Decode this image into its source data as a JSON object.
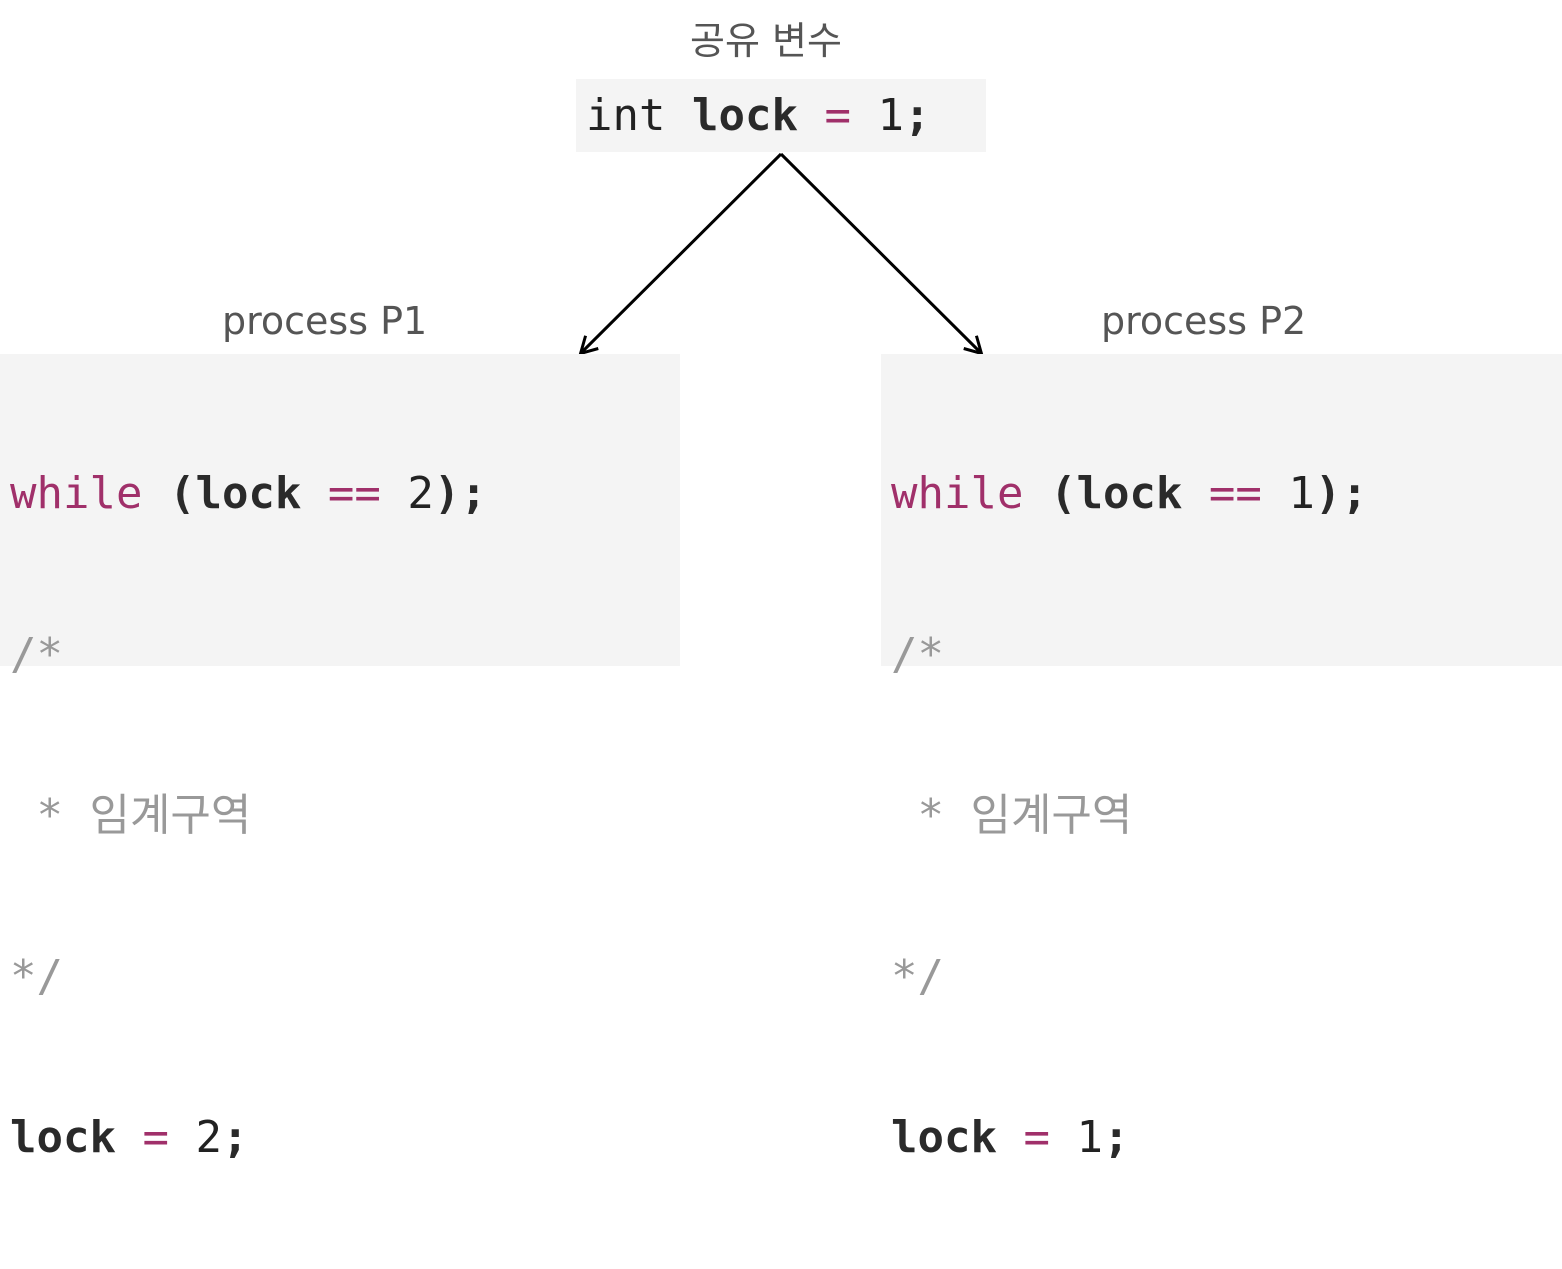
{
  "shared": {
    "title": "공유 변수",
    "decl": {
      "type": "int",
      "name": "lock",
      "op": "=",
      "value": "1",
      "end": ";"
    }
  },
  "p1": {
    "title": "process P1",
    "while_kw": "while",
    "open": "(",
    "var": "lock",
    "cmp": "==",
    "cmp_value": "2",
    "close": ");",
    "comment_start": "/*",
    "comment_body": " * 임계구역",
    "comment_end": "*/",
    "assign_var": "lock",
    "assign_op": "=",
    "assign_value": "2",
    "assign_end": ";"
  },
  "p2": {
    "title": "process P2",
    "while_kw": "while",
    "open": "(",
    "var": "lock",
    "cmp": "==",
    "cmp_value": "1",
    "close": ");",
    "comment_start": "/*",
    "comment_body": " * 임계구역",
    "comment_end": "*/",
    "assign_var": "lock",
    "assign_op": "=",
    "assign_value": "1",
    "assign_end": ";"
  },
  "colors": {
    "keyword": "#a0306a",
    "comment": "#999999",
    "box": "#f4f4f4",
    "label": "#555555"
  }
}
